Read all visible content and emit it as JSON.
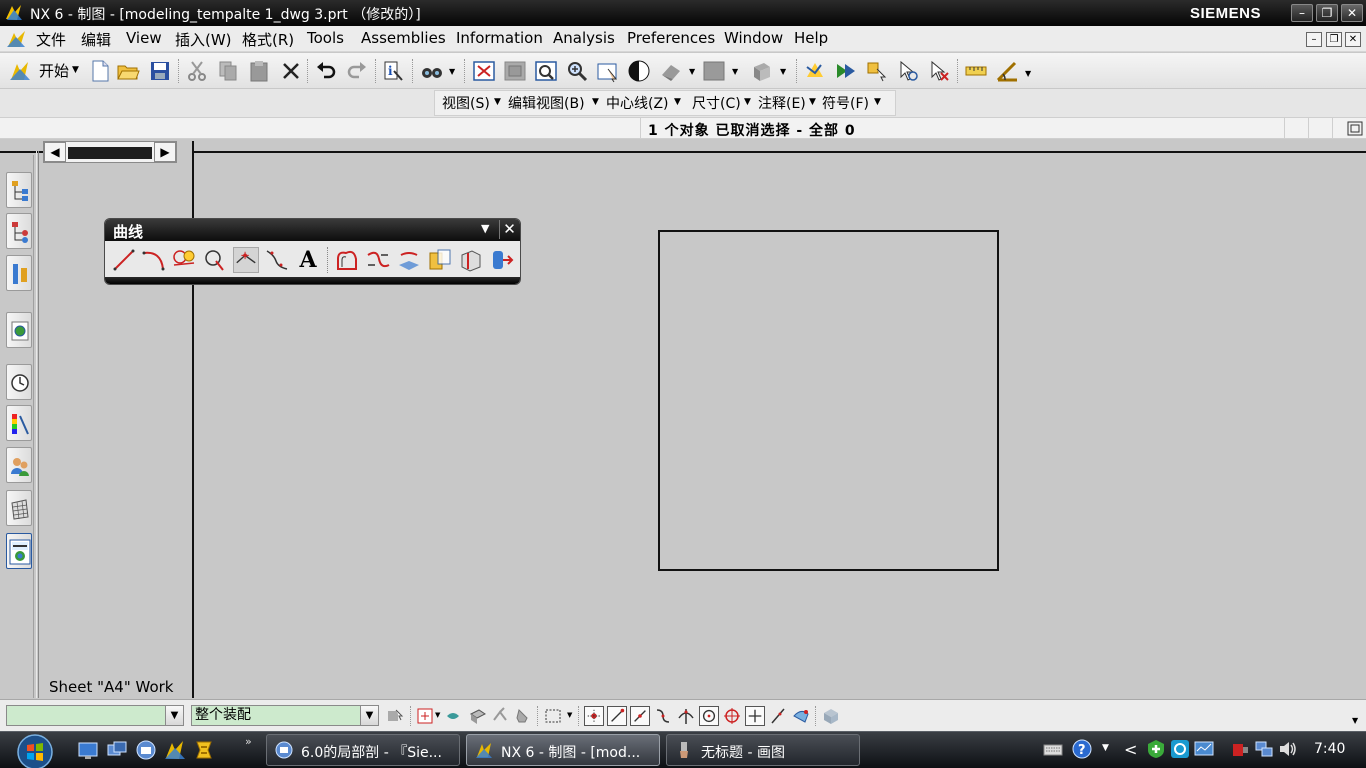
{
  "window": {
    "title": "NX 6 - 制图 - [modeling_tempalte 1_dwg 3.prt （修改的）]",
    "brand": "SIEMENS",
    "buttons": {
      "minimize": "–",
      "restore": "❐",
      "close": "✕"
    }
  },
  "menubar": {
    "items": [
      "文件",
      "编辑",
      "View",
      "插入(W)",
      "格式(R)",
      "Tools",
      "Assemblies",
      "Information",
      "Analysis",
      "Preferences",
      "Window",
      "Help"
    ]
  },
  "toolbar": {
    "start_label": "开始"
  },
  "drafting_toolbar": {
    "items": [
      "视图(S)",
      "编辑视图(B)",
      "中心线(Z)",
      "尺寸(C)",
      "注释(E)",
      "符号(F)"
    ]
  },
  "status": {
    "message": "1 个对象 已取消选择  - 全部 0"
  },
  "navigator": {
    "sheet_label": "Sheet \"A4\" Work"
  },
  "curve_toolbar": {
    "title": "曲线",
    "text_tool": "A"
  },
  "selection_bar": {
    "filter_value": "",
    "scope_value": "整个装配"
  },
  "taskbar": {
    "tasks": [
      "6.0的局部剖 - 『Sie...",
      "NX 6 - 制图 - [mod...",
      "无标题 - 画图"
    ],
    "active_task": 1,
    "clock": "7:40"
  },
  "colors": {
    "title_bar": "#0d0d0d",
    "canvas_bg": "#c8c8c8",
    "combo_bg": "#cdeacd",
    "taskbar": "#1f2328"
  }
}
